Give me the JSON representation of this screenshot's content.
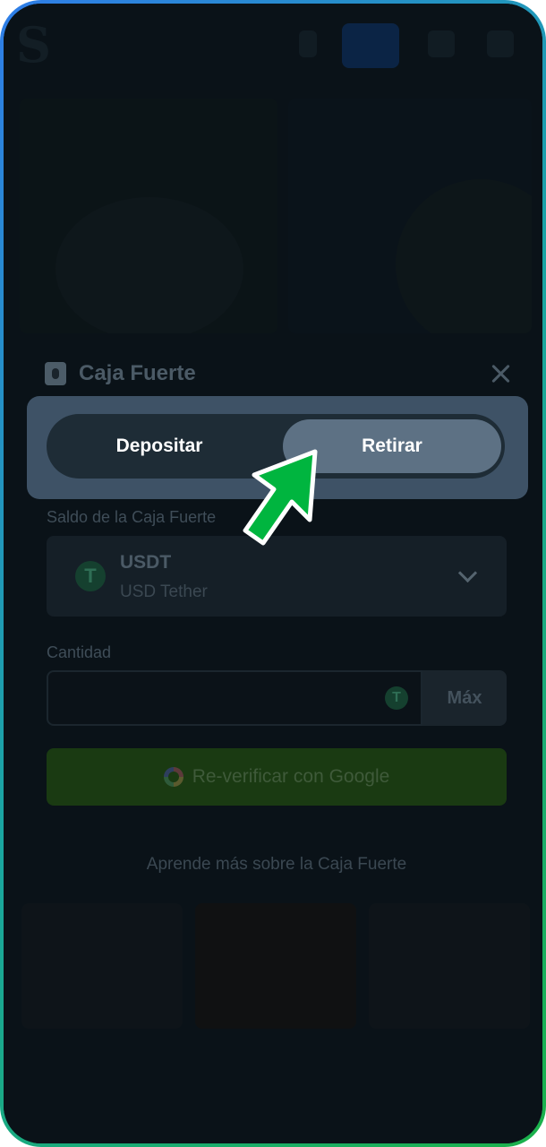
{
  "modal": {
    "title": "Caja Fuerte",
    "tabs": {
      "deposit": "Depositar",
      "withdraw": "Retirar"
    },
    "vault_balance_label": "Saldo de la Caja Fuerte",
    "currency": {
      "code": "USDT",
      "name": "USD Tether",
      "coin_glyph": "T"
    },
    "amount_label": "Cantidad",
    "amount_value": "",
    "max_label": "Máx",
    "google_button": "Re-verificar con Google",
    "learn_more": "Aprende más sobre la Caja Fuerte"
  },
  "colors": {
    "accent_green": "#00b53f",
    "active_tab": "#5d7184",
    "frame_blue": "#2f7de8",
    "frame_green": "#1bb14a"
  }
}
